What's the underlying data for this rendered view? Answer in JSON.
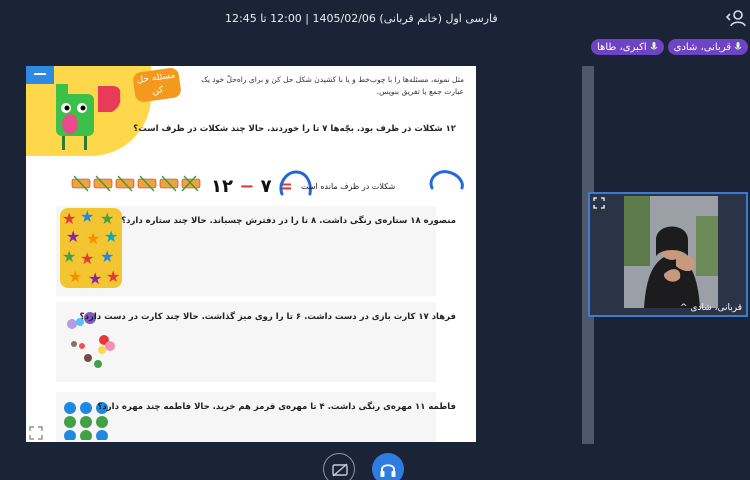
{
  "header": {
    "title": "فارسی اول (خانم قربانی) 1405/02/06 | 12:00 تا 12:45"
  },
  "participants": [
    {
      "name": "قربانی، شادی"
    },
    {
      "name": "اکبری، طاها"
    }
  ],
  "document": {
    "badge": "مسئله حل کن",
    "intro": "مثل نمونه، مسئله‌ها را با چوب‌خط و یا با کشیدن شکل حل کن و برای راه‌حلّ خود یک عبارت جمع یا تفریق بنویس.",
    "questions": [
      "۱۲ شکلات در ظرف بود. بچّه‌ها ۷ تا را خوردند. حالا چند شکلات در ظرف است؟",
      "منصوره ۱۸ ستاره‌ی رنگی داشت. ۸ تا را در دفترش چسباند. حالا چند ستاره دارد؟",
      "فرهاد ۱۷ کارت بازی در دست داشت. ۶ تا را روی میز گذاشت. حالا چند کارت در دست دارد؟",
      "فاطمه ۱۱ مهره‌ی رنگی داشت. ۴ تا مهره‌ی قرمز هم خرید. حالا فاطمه چند مهره دارد؟"
    ],
    "equation": {
      "left": "۱۲",
      "minus": "−",
      "right": "۷",
      "equals": "="
    },
    "answer_note": "شکلات در ظرف مانده است"
  },
  "video": {
    "name": "قربانی، شادی"
  },
  "icons": {
    "user": "user-icon",
    "mic": "mic-icon",
    "expand": "expand-icon",
    "share": "screen-share-off-icon",
    "audio": "headphones-icon"
  },
  "colors": {
    "background": "#1b2436",
    "chip": "#6e43c5",
    "accent": "#2f7de1",
    "video_border": "#3b7bd4"
  }
}
